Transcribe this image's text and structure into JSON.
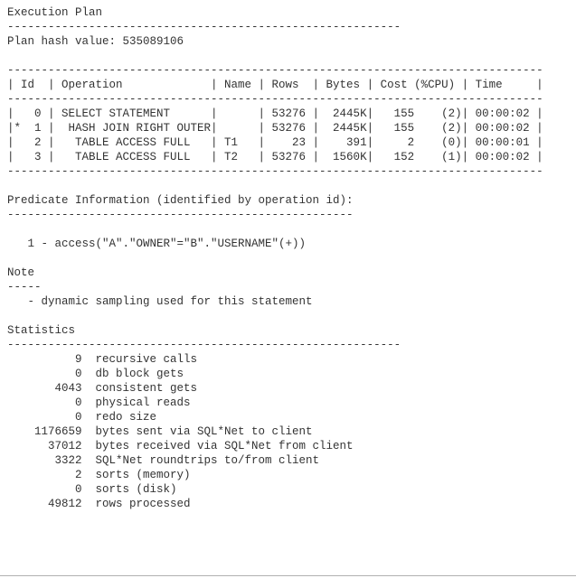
{
  "header": {
    "title": "Execution Plan",
    "title_rule": "----------------------------------------------------------",
    "plan_hash_label": "Plan hash value:",
    "plan_hash_value": "535089106"
  },
  "plan_table": {
    "rule": "-------------------------------------------------------------------------------",
    "headers": {
      "id": "Id",
      "operation": "Operation",
      "name": "Name",
      "rows": "Rows",
      "bytes": "Bytes",
      "cost": "Cost (%CPU)",
      "time": "Time"
    },
    "rows": [
      {
        "mark": " ",
        "id": "0",
        "operation": "SELECT STATEMENT",
        "name": "",
        "rows": "53276",
        "bytes": "2445K",
        "cost": "155",
        "cpu": "(2)",
        "time": "00:00:02"
      },
      {
        "mark": "*",
        "id": "1",
        "operation": " HASH JOIN RIGHT OUTER",
        "name": "",
        "rows": "53276",
        "bytes": "2445K",
        "cost": "155",
        "cpu": "(2)",
        "time": "00:00:02"
      },
      {
        "mark": " ",
        "id": "2",
        "operation": "  TABLE ACCESS FULL",
        "name": "T1",
        "rows": "23",
        "bytes": "391",
        "cost": "2",
        "cpu": "(0)",
        "time": "00:00:01"
      },
      {
        "mark": " ",
        "id": "3",
        "operation": "  TABLE ACCESS FULL",
        "name": "T2",
        "rows": "53276",
        "bytes": "1560K",
        "cost": "152",
        "cpu": "(1)",
        "time": "00:00:02"
      }
    ]
  },
  "predicate": {
    "title": "Predicate Information (identified by operation id):",
    "rule": "---------------------------------------------------",
    "line": "1 - access(\"A\".\"OWNER\"=\"B\".\"USERNAME\"(+))"
  },
  "note": {
    "title": "Note",
    "rule": "-----",
    "line": "- dynamic sampling used for this statement"
  },
  "statistics": {
    "title": "Statistics",
    "rule": "----------------------------------------------------------",
    "items": [
      {
        "value": "9",
        "label": "recursive calls"
      },
      {
        "value": "0",
        "label": "db block gets"
      },
      {
        "value": "4043",
        "label": "consistent gets"
      },
      {
        "value": "0",
        "label": "physical reads"
      },
      {
        "value": "0",
        "label": "redo size"
      },
      {
        "value": "1176659",
        "label": "bytes sent via SQL*Net to client"
      },
      {
        "value": "37012",
        "label": "bytes received via SQL*Net from client"
      },
      {
        "value": "3322",
        "label": "SQL*Net roundtrips to/from client"
      },
      {
        "value": "2",
        "label": "sorts (memory)"
      },
      {
        "value": "0",
        "label": "sorts (disk)"
      },
      {
        "value": "49812",
        "label": "rows processed"
      }
    ]
  }
}
